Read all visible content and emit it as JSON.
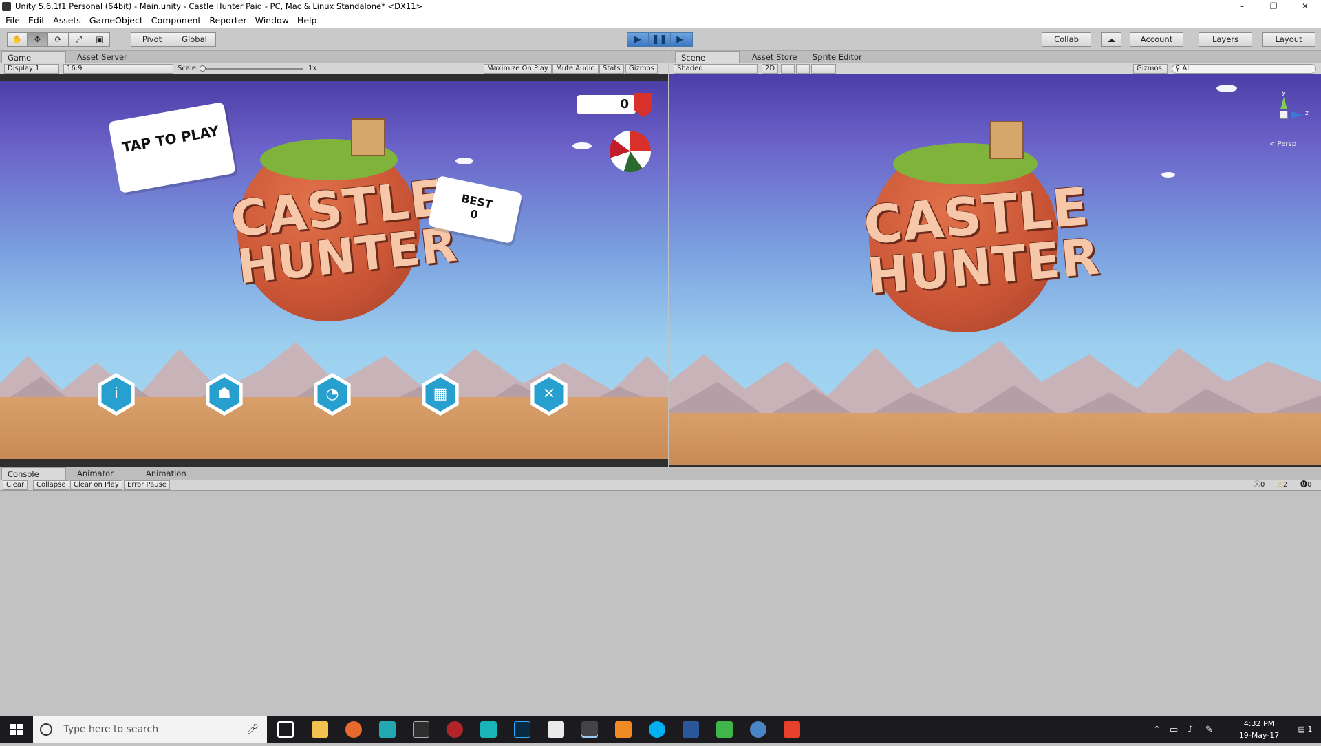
{
  "window": {
    "title": "Unity 5.6.1f1 Personal (64bit) - Main.unity - Castle Hunter Paid - PC, Mac & Linux Standalone* <DX11>",
    "minimize": "–",
    "restore": "❐",
    "close": "✕"
  },
  "menu": [
    "File",
    "Edit",
    "Assets",
    "GameObject",
    "Component",
    "Reporter",
    "Window",
    "Help"
  ],
  "toolbar": {
    "tools": [
      "✋",
      "✥",
      "⟳",
      "⤢",
      "▣"
    ],
    "pivot": "Pivot",
    "global": "Global",
    "play": "▶",
    "pause": "❚❚",
    "step": "▶|",
    "collab": "Collab",
    "cloud": "☁",
    "account": "Account",
    "layers": "Layers",
    "layout": "Layout"
  },
  "game_panel": {
    "tabs": [
      "Game",
      "Asset Server"
    ],
    "display": "Display 1",
    "aspect": "16:9",
    "scale_label": "Scale",
    "scale_value": "1x",
    "options": [
      "Maximize On Play",
      "Mute Audio",
      "Stats",
      "Gizmos"
    ],
    "game": {
      "tap_bubble": "TAP TO PLAY",
      "best_label": "BEST",
      "best_value": "0",
      "score": "0",
      "logo_line1": "CASTLE",
      "logo_line2": "HUNTER",
      "buttons": [
        "info-icon",
        "medal-icon",
        "cannon-icon",
        "gift-icon",
        "tools-icon"
      ]
    }
  },
  "scene_panel": {
    "tabs": [
      "Scene",
      "Asset Store",
      "Sprite Editor"
    ],
    "shading": "Shaded",
    "mode_2d": "2D",
    "gizmos": "Gizmos",
    "search_placeholder": "All",
    "persp": "< Persp",
    "axis_y": "y",
    "axis_z": "z",
    "logo_line1": "CASTLE",
    "logo_line2": "HUNTER"
  },
  "console_panel": {
    "tabs": [
      "Console",
      "Animator",
      "Animation"
    ],
    "buttons": [
      "Clear",
      "Collapse",
      "Clear on Play",
      "Error Pause"
    ],
    "counts": {
      "info": "0",
      "warnings": "2",
      "errors": "0"
    }
  },
  "taskbar": {
    "search_placeholder": "Type here to search",
    "time": "4:32 PM",
    "date": "19-May-17",
    "notification_count": "1",
    "apps": [
      "task-view",
      "file-explorer",
      "firefox",
      "app-store",
      "epic-games",
      "app-red",
      "maya",
      "photoshop",
      "mail",
      "unity",
      "media-player",
      "skype",
      "word",
      "camtasia",
      "app-blue",
      "app-orange"
    ]
  },
  "colors": {
    "accent_blue": "#28a0cf",
    "play_blue": "#3b78c4",
    "planet": "#c95435",
    "logo": "#f6c8a9"
  }
}
